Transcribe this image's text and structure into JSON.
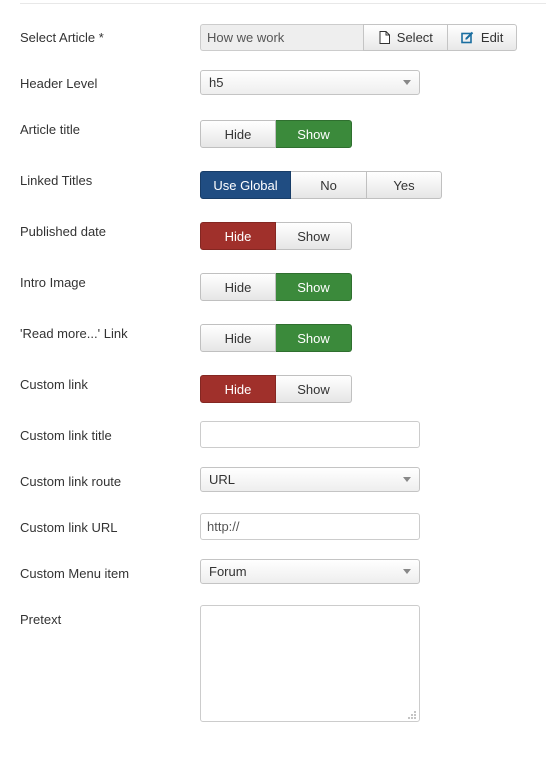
{
  "form": {
    "select_article": {
      "label": "Select Article *",
      "value": "How we work",
      "select_button": "Select",
      "select_icon": "file-icon",
      "edit_button": "Edit",
      "edit_icon": "edit-icon"
    },
    "header_level": {
      "label": "Header Level",
      "value": "h5"
    },
    "article_title": {
      "label": "Article title",
      "options": [
        "Hide",
        "Show"
      ],
      "selected": "Show"
    },
    "linked_titles": {
      "label": "Linked Titles",
      "options": [
        "Use Global",
        "No",
        "Yes"
      ],
      "selected": "Use Global"
    },
    "published_date": {
      "label": "Published date",
      "options": [
        "Hide",
        "Show"
      ],
      "selected": "Hide"
    },
    "intro_image": {
      "label": "Intro Image",
      "options": [
        "Hide",
        "Show"
      ],
      "selected": "Show"
    },
    "read_more_link": {
      "label": "'Read more...' Link",
      "options": [
        "Hide",
        "Show"
      ],
      "selected": "Show"
    },
    "custom_link": {
      "label": "Custom link",
      "options": [
        "Hide",
        "Show"
      ],
      "selected": "Hide"
    },
    "custom_link_title": {
      "label": "Custom link title",
      "value": ""
    },
    "custom_link_route": {
      "label": "Custom link route",
      "value": "URL"
    },
    "custom_link_url": {
      "label": "Custom link URL",
      "value": "http://"
    },
    "custom_menu_item": {
      "label": "Custom Menu item",
      "value": "Forum"
    },
    "pretext": {
      "label": "Pretext",
      "value": ""
    }
  },
  "colors": {
    "show_active": "#3b8a3b",
    "hide_active": "#a0302b",
    "global_active": "#204d82"
  }
}
